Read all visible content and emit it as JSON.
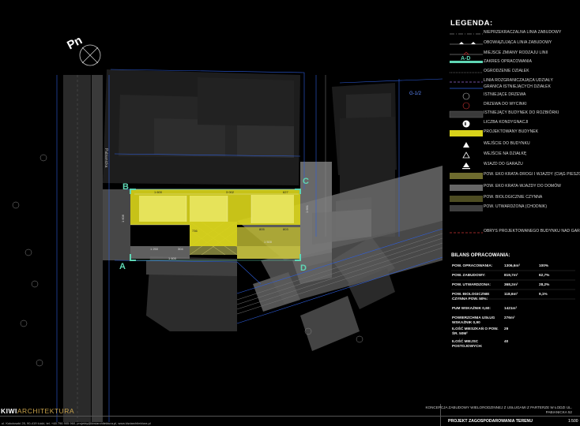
{
  "north": {
    "label": "Pn"
  },
  "street": {
    "name": "Pabianicka",
    "parcel_code": "G-1/2"
  },
  "corners": {
    "a": "A",
    "b": "B",
    "c": "C",
    "d": "D"
  },
  "dims": {
    "top_1": "1 600",
    "top_2": "3 002",
    "top_3": "627",
    "left_side": "1 606",
    "right_side": "1 661",
    "bottom_1": "1 250",
    "bottom_2": "1 500",
    "bottom_3": "304",
    "bottom_4": "1 600",
    "inner_1": "736",
    "inner_2": "803",
    "inner_3": "805"
  },
  "legend": {
    "title": "LEGENDA:",
    "items": [
      {
        "label": "NIEPRZEKRACZALNA LINIA ZABUDOWY",
        "symbol": "line-dashdot"
      },
      {
        "label": "OBOWIĄZUJĄCA LINIA ZABUDOWY",
        "symbol": "line-triangles"
      },
      {
        "label": "MIEJSCE ZMIANY RODZAJU LINII",
        "symbol": "line-change"
      },
      {
        "label": "ZAKRES OPRACOWANIA",
        "symbol": "teal-range",
        "tag": "A-D"
      },
      {
        "label": "OGRODZENIE DZIAŁEK",
        "symbol": "line-fence"
      },
      {
        "label": "LINIA ROZGRANICZAJĄCA UDZIAŁY",
        "symbol": "line-dashed-purple"
      },
      {
        "label": "GRANICA ISTNIEJĄCYCH DZIAŁEK",
        "symbol": "line-blue"
      },
      {
        "label": "ISTNIEJĄCE DRZEWA",
        "symbol": "circle"
      },
      {
        "label": "DRZEWA DO WYCINKI",
        "symbol": "circle-red"
      },
      {
        "label": "ISTNIEJĄCY BUDYNEK DO ROZBIÓRKI",
        "symbol": "box-demolish"
      },
      {
        "label": "LICZBA KONDYGNACJI",
        "symbol": "floors",
        "tag": "II"
      },
      {
        "label": "PROJEKTOWANY BUDYNEK",
        "symbol": "yellow"
      },
      {
        "label": "WEJŚCIE DO BUDYNKU",
        "symbol": "tri-white"
      },
      {
        "label": "WEJŚCIE NA DZIAŁKĘ",
        "symbol": "tri-open"
      },
      {
        "label": "WJAZD DO GARAŻU",
        "symbol": "tri-bar"
      },
      {
        "label": "POW. EKO KRATA-DROGI I WJAZDY (CIĄG PIESZO - JEZDNY)",
        "symbol": "box-olive"
      },
      {
        "label": "POW. EKO KRATA-WJAZDY DO DOMÓW",
        "symbol": "box-grey"
      },
      {
        "label": "POW. BIOLOGICZNIE CZYNNA",
        "symbol": "box-bio"
      },
      {
        "label": "POW. UTWARDZONA (CHODNIK)",
        "symbol": "box-dark"
      },
      {
        "label": "OBRYS PROJEKTOWANEGO BUDYNKU NAD GARAŻEM",
        "symbol": "line-red-dashed"
      }
    ]
  },
  "bilans": {
    "title": "BILANS OPRACOWANIA:",
    "rows": [
      {
        "name": "POW. OPRACOWANIA:",
        "value": "1306,6m²",
        "percent": "100%"
      },
      {
        "name": "POW. ZABUDOWY:",
        "value": "819,7m²",
        "percent": "62,7%"
      },
      {
        "name": "POW. UTWARDZONA:",
        "value": "368,2m²",
        "percent": "28,2%"
      },
      {
        "name": "POW. BIOLOGICZNIE CZYNNA POW. 50%:",
        "value": "118,6m²",
        "percent": "9,1%"
      },
      {
        "name": "PUM WSKAŹNIK 0,60:",
        "value": "1421m²",
        "percent": ""
      },
      {
        "name": "POWIERZCHNIA USŁUG WSKAŹNIK 0,90",
        "value": "276m²",
        "percent": ""
      },
      {
        "name": "ILOŚĆ MIESZKAŃ O POW. ŚR. 50M²",
        "value": "29",
        "percent": ""
      },
      {
        "name": "ILOŚĆ MIEJSC POSTOJOWYCH:",
        "value": "40",
        "percent": ""
      }
    ]
  },
  "title_block": {
    "logo_bold": "KIWI",
    "logo_rest": "ARCHITEKTURA",
    "contact": "ul. Kokciuszki 25, 90-419 Łódź, tel. +48 796 905 960, projekty@kiwiarchitektura.pl, www.kiwiarchitektura.pl",
    "description": "KONCEPCJA ZABUDOWY WIELORODZINNEJ Z USŁUGAMI Z PARTERZE W ŁODZI UL. PABIANICKA 52",
    "project": "PROJEKT ZAGOSPODAROWANIA TERENU",
    "scale": "1:500"
  },
  "colors": {
    "background": "#000000",
    "building_proposed": "#d8d21a",
    "building_light": "#e6e35a",
    "accent_teal": "#5fd6b4",
    "existing_dark": "#1f1f1f",
    "shadow_grey": "#6a6a6a",
    "plot_blue": "#2e5fe0",
    "logo_gold": "#c8a24a"
  }
}
